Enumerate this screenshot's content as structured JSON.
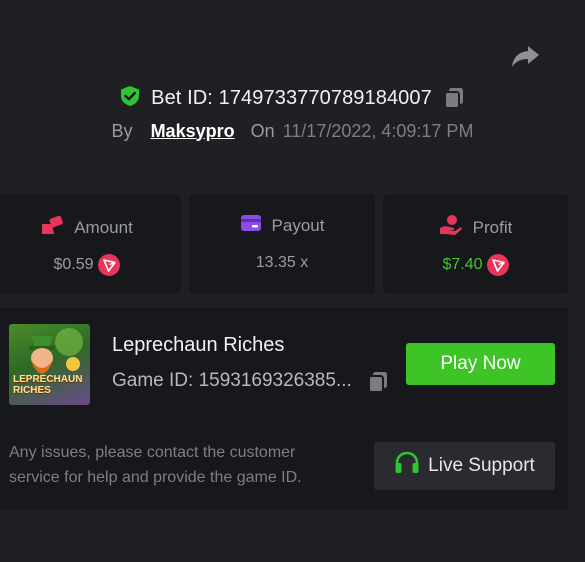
{
  "header": {
    "bet_id_text": "Bet ID: 1749733770789184007",
    "by_label": "By",
    "username": "Maksypro",
    "on_label": "On",
    "datetime": "11/17/2022, 4:09:17 PM"
  },
  "stats": {
    "amount": {
      "label": "Amount",
      "value": "$0.59"
    },
    "payout": {
      "label": "Payout",
      "value": "13.35 x"
    },
    "profit": {
      "label": "Profit",
      "value": "$7.40"
    }
  },
  "game": {
    "name": "Leprechaun Riches",
    "id_text": "Game ID: 1593169326385...",
    "thumb_line1": "LEPRECHAUN",
    "thumb_line2": "RICHES",
    "play_label": "Play Now"
  },
  "support": {
    "help_text": "Any issues, please contact the customer service for help and provide the game ID.",
    "button_label": "Live Support"
  },
  "colors": {
    "background": "#1f2024",
    "card": "#17181b",
    "accent_green": "#3fc427",
    "profit_green": "#45c52a",
    "coin_red": "#e8365b"
  },
  "icons": {
    "share": "share-icon",
    "verified": "shield-check-icon",
    "copy": "copy-icon",
    "amount": "bet-amount-icon",
    "payout": "wallet-card-icon",
    "profit": "hand-coin-icon",
    "coin": "tron-coin-icon",
    "support": "headset-icon"
  }
}
